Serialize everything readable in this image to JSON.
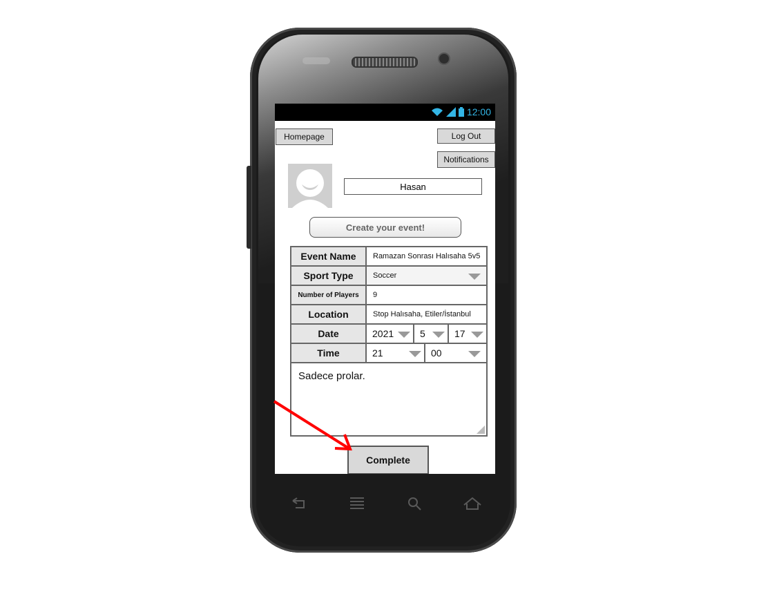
{
  "status_bar": {
    "time": "12:00"
  },
  "nav": {
    "homepage": "Homepage",
    "logout": "Log Out",
    "notifications": "Notifications"
  },
  "user": {
    "name": "Hasan"
  },
  "create_event": "Create your event!",
  "form": {
    "event_name_label": "Event Name",
    "event_name_value": "Ramazan Sonrası Halısaha 5v5",
    "sport_type_label": "Sport Type",
    "sport_type_value": "Soccer",
    "players_label": "Number of Players",
    "players_value": "9",
    "location_label": "Location",
    "location_value": "Stop Halısaha, Etiler/İstanbul",
    "date_label": "Date",
    "date_year": "2021",
    "date_month": "5",
    "date_day": "17",
    "time_label": "Time",
    "time_hour": "21",
    "time_minute": "00",
    "notes": "Sadece prolar."
  },
  "complete_button": "Complete",
  "colors": {
    "annotation_arrow": "#ff0000",
    "status_icons": "#33b5e5"
  }
}
